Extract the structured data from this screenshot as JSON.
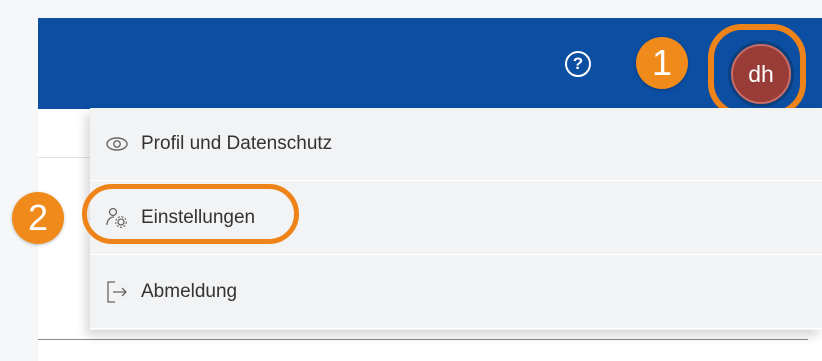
{
  "header": {
    "help_icon": "help-circle-icon",
    "help_glyph": "?",
    "avatar_initials": "dh",
    "colors": {
      "bar": "#0b4ea2",
      "avatar": "#993b36",
      "highlight": "#ee8419"
    }
  },
  "callouts": {
    "step_1": "1",
    "step_2": "2"
  },
  "menu": {
    "items": [
      {
        "label": "Profil und Datenschutz",
        "icon": "eye-icon"
      },
      {
        "label": "Einstellungen",
        "icon": "user-settings-icon"
      },
      {
        "label": "Abmeldung",
        "icon": "logout-icon"
      }
    ]
  }
}
